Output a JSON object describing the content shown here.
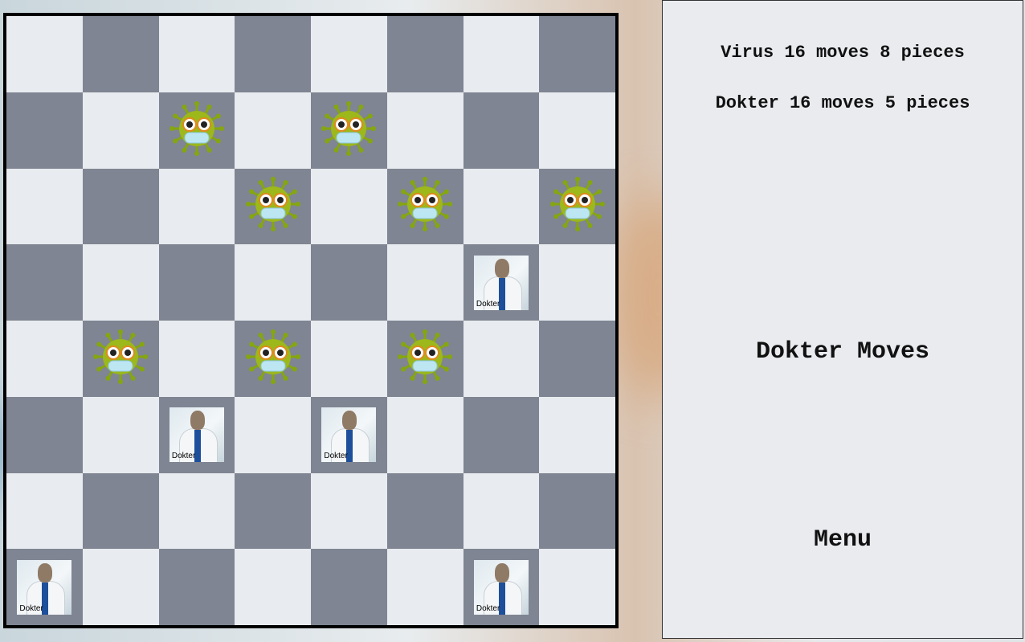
{
  "stats": {
    "virus": "Virus 16 moves 8 pieces",
    "dokter": "Dokter 16 moves 5 pieces"
  },
  "turn_label": "Dokter Moves",
  "menu_label": "Menu",
  "doctor_label": "Dokter",
  "board": [
    [
      "",
      "",
      "",
      "",
      "",
      "",
      "",
      ""
    ],
    [
      "",
      "",
      "V",
      "",
      "V",
      "",
      "",
      ""
    ],
    [
      "",
      "",
      "",
      "V",
      "",
      "V",
      "",
      "V"
    ],
    [
      "",
      "",
      "",
      "",
      "",
      "",
      "D",
      ""
    ],
    [
      "",
      "V",
      "",
      "V",
      "",
      "V",
      "",
      ""
    ],
    [
      "",
      "",
      "D",
      "",
      "D",
      "",
      "",
      ""
    ],
    [
      "",
      "",
      "",
      "",
      "",
      "",
      "",
      ""
    ],
    [
      "D",
      "",
      "",
      "",
      "",
      "",
      "D",
      ""
    ]
  ],
  "colors": {
    "light_square": "#e8ebef",
    "dark_square": "#7f8592",
    "virus_body": "#9cb81a",
    "virus_spike": "#86a60f"
  }
}
